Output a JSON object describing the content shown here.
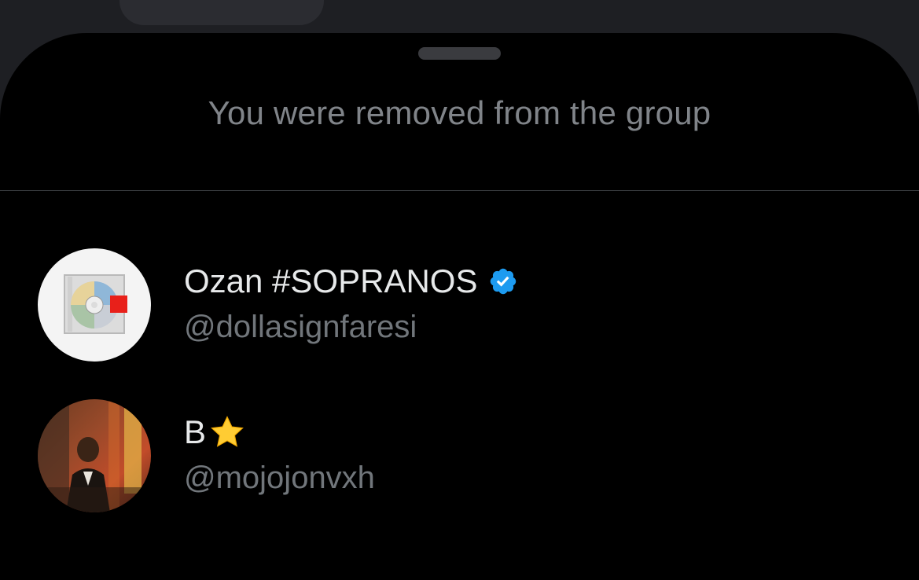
{
  "sheet": {
    "title": "You were removed from the group"
  },
  "members": [
    {
      "display_name": "Ozan #SOPRANOS",
      "handle": "@dollasignfaresi",
      "badge_icon": "verified-badge-icon",
      "avatar_icon": "album-cover-avatar"
    },
    {
      "display_name": "B",
      "handle": "@mojojonvxh",
      "name_emoji_icon": "star-icon",
      "avatar_icon": "photo-avatar"
    }
  ],
  "colors": {
    "sheet_background": "#000000",
    "backdrop": "#1e1f23",
    "primary_text": "#e7e9ea",
    "secondary_text": "#71767b",
    "verified_blue": "#1d9bf0",
    "star_yellow": "#ffcc33"
  }
}
